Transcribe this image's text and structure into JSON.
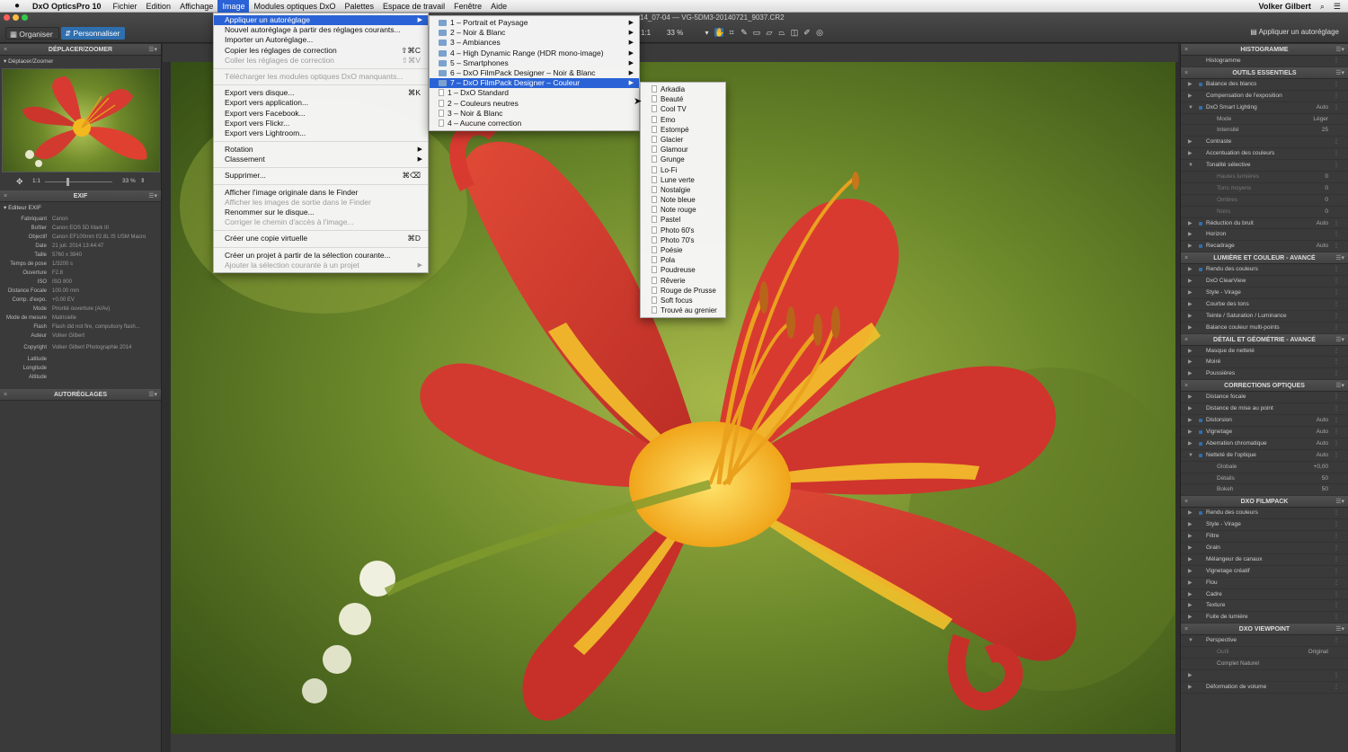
{
  "menubar": {
    "app_name": "DxO OpticsPro 10",
    "menus": [
      "Fichier",
      "Edition",
      "Affichage",
      "Image",
      "Modules optiques DxO",
      "Palettes",
      "Espace de travail",
      "Fenêtre",
      "Aide"
    ],
    "active_menu": "Image",
    "user": "Volker Gilbert"
  },
  "toolbar": {
    "document_title": "14_07-04 — VG-5DM3-20140721_9037.CR2",
    "organiser": "Organiser",
    "personnaliser": "Personnaliser",
    "ratio": "1:1",
    "zoom": "33 %",
    "apply_preset": "Appliquer un autoréglage"
  },
  "left": {
    "nav_panel_title": "DÉPLACER/ZOOMER",
    "nav_sub": "Déplacer/Zoomer",
    "zoom_ratio": "1:1",
    "zoom_value": "33 %",
    "exif_title": "EXIF",
    "exif_sub": "Editeur EXIF",
    "exif": [
      {
        "k": "Fabriquant",
        "v": "Canon"
      },
      {
        "k": "Boîtier",
        "v": "Canon EOS 5D Mark III"
      },
      {
        "k": "Objectif",
        "v": "Canon EF100mm f/2.8L IS USM Macro"
      },
      {
        "k": "Date",
        "v": "21 juil. 2014 13:44:47"
      },
      {
        "k": "Taille",
        "v": "5760 x 3840"
      },
      {
        "k": "Temps de pose",
        "v": "1/3200 s"
      },
      {
        "k": "Ouverture",
        "v": "F2.8"
      },
      {
        "k": "ISO",
        "v": "ISO 800"
      },
      {
        "k": "Distance Focale",
        "v": "100.00 mm"
      },
      {
        "k": "Comp. d'expo.",
        "v": "+0.00 EV"
      },
      {
        "k": "Mode",
        "v": "Priorité ouverture (A/Av)"
      },
      {
        "k": "Mode de mesure",
        "v": "Matricielle"
      },
      {
        "k": "Flash",
        "v": "Flash did not fire, compulsory flash..."
      },
      {
        "k": "Auteur",
        "v": "Volker Gilbert"
      },
      {
        "k": "Copyright",
        "v": "Volker Gilbert Photographie 2014"
      },
      {
        "k": "Latitude",
        "v": ""
      },
      {
        "k": "Longitude",
        "v": ""
      },
      {
        "k": "Altitude",
        "v": ""
      }
    ],
    "presets_title": "AUTORÉGLAGES"
  },
  "image_menu": [
    {
      "label": "Appliquer un autoréglage",
      "sub": true,
      "hl": true
    },
    {
      "label": "Nouvel autoréglage à partir des réglages courants..."
    },
    {
      "label": "Importer un Autoréglage..."
    },
    {
      "label": "Copier les réglages de correction",
      "sc": "⇧⌘C"
    },
    {
      "label": "Coller les réglages de correction",
      "sc": "⇧⌘V",
      "dis": true
    },
    {
      "sep": true
    },
    {
      "label": "Télécharger les modules optiques DxO manquants...",
      "dis": true
    },
    {
      "sep": true
    },
    {
      "label": "Export vers disque...",
      "sc": "⌘K"
    },
    {
      "label": "Export vers application..."
    },
    {
      "label": "Export vers Facebook..."
    },
    {
      "label": "Export vers Flickr..."
    },
    {
      "label": "Export vers Lightroom..."
    },
    {
      "sep": true
    },
    {
      "label": "Rotation",
      "sub": true
    },
    {
      "label": "Classement",
      "sub": true
    },
    {
      "sep": true
    },
    {
      "label": "Supprimer...",
      "sc": "⌘⌫"
    },
    {
      "sep": true
    },
    {
      "label": "Afficher l'image originale dans le Finder"
    },
    {
      "label": "Afficher les images de sortie dans le Finder",
      "dis": true
    },
    {
      "label": "Renommer sur le disque..."
    },
    {
      "label": "Corriger le chemin d'accès à l'image...",
      "dis": true
    },
    {
      "sep": true
    },
    {
      "label": "Créer une copie virtuelle",
      "sc": "⌘D"
    },
    {
      "sep": true
    },
    {
      "label": "Créer un projet à partir de la sélection courante..."
    },
    {
      "label": "Ajouter la sélection courante à un projet",
      "sub": true,
      "dis": true
    }
  ],
  "preset_menu": [
    {
      "label": "1 – Portrait et Paysage",
      "folder": true,
      "sub": true
    },
    {
      "label": "2 – Noir & Blanc",
      "folder": true,
      "sub": true
    },
    {
      "label": "3 – Ambiances",
      "folder": true,
      "sub": true
    },
    {
      "label": "4 – High Dynamic Range (HDR mono-image)",
      "folder": true,
      "sub": true
    },
    {
      "label": "5 – Smartphones",
      "folder": true,
      "sub": true
    },
    {
      "label": "6 – DxO FilmPack Designer – Noir & Blanc",
      "folder": true,
      "sub": true
    },
    {
      "label": "7 – DxO FilmPack Designer – Couleur",
      "folder": true,
      "sub": true,
      "hl": true
    },
    {
      "label": "1 – DxO Standard",
      "file": true
    },
    {
      "label": "2 – Couleurs neutres",
      "file": true
    },
    {
      "label": "3 – Noir & Blanc",
      "file": true
    },
    {
      "label": "4 – Aucune correction",
      "file": true
    }
  ],
  "filmpack_menu": [
    "Arkadia",
    "Beauté",
    "Cool TV",
    "Emo",
    "Estompé",
    "Glacier",
    "Glamour",
    "Grunge",
    "Lo-Fi",
    "Lune verte",
    "Nostalgie",
    "Note bleue",
    "Note rouge",
    "Pastel",
    "Photo 60's",
    "Photo 70's",
    "Poésie",
    "Pola",
    "Poudreuse",
    "Rêverie",
    "Rouge de Prusse",
    "Soft focus",
    "Trouvé au grenier"
  ],
  "right": {
    "sections": [
      {
        "title": "HISTOGRAMME",
        "rows": [
          {
            "label": "Histogramme",
            "tri": false
          }
        ]
      },
      {
        "title": "OUTILS ESSENTIELS",
        "rows": [
          {
            "label": "Balance des blancs",
            "dot": true
          },
          {
            "label": "Compensation de l'exposition"
          },
          {
            "label": "DxO Smart Lighting",
            "dot": true,
            "val": "Auto",
            "open": true
          },
          {
            "label": "Mode",
            "sub": true,
            "val": "Léger"
          },
          {
            "label": "Intensité",
            "sub": true,
            "val": "25"
          },
          {
            "label": "Contraste"
          },
          {
            "label": "Accentuation des couleurs"
          },
          {
            "label": "Tonalité sélective",
            "open": true
          },
          {
            "label": "Hautes lumières",
            "sub": true,
            "dim": true,
            "val": "0"
          },
          {
            "label": "Tons moyens",
            "sub": true,
            "dim": true,
            "val": "0"
          },
          {
            "label": "Ombres",
            "sub": true,
            "dim": true,
            "val": "0"
          },
          {
            "label": "Noirs",
            "sub": true,
            "dim": true,
            "val": "0"
          },
          {
            "label": "Réduction du bruit",
            "dot": true,
            "val": "Auto"
          },
          {
            "label": "Horizon"
          },
          {
            "label": "Recadrage",
            "dot": true,
            "val": "Auto"
          }
        ]
      },
      {
        "title": "LUMIÈRE ET COULEUR - AVANCÉ",
        "rows": [
          {
            "label": "Rendu des couleurs",
            "dot": true
          },
          {
            "label": "DxO ClearView"
          },
          {
            "label": "Style - Virage"
          },
          {
            "label": "Courbe des tons"
          },
          {
            "label": "Teinte / Saturation / Luminance"
          },
          {
            "label": "Balance couleur multi-points"
          }
        ]
      },
      {
        "title": "DÉTAIL ET GÉOMÉTRIE - AVANCÉ",
        "rows": [
          {
            "label": "Masque de netteté"
          },
          {
            "label": "Moiré"
          },
          {
            "label": "Poussières"
          }
        ]
      },
      {
        "title": "CORRECTIONS OPTIQUES",
        "rows": [
          {
            "label": "Distance focale"
          },
          {
            "label": "Distance de mise au point"
          },
          {
            "label": "Distorsion",
            "dot": true,
            "val": "Auto"
          },
          {
            "label": "Vignetage",
            "dot": true,
            "val": "Auto"
          },
          {
            "label": "Aberration chromatique",
            "dot": true,
            "val": "Auto"
          },
          {
            "label": "Netteté de l'optique",
            "dot": true,
            "val": "Auto",
            "open": true
          },
          {
            "label": "Globale",
            "sub": true,
            "val": "+0,00"
          },
          {
            "label": "Détails",
            "sub": true,
            "val": "50"
          },
          {
            "label": "Bokeh",
            "sub": true,
            "val": "50"
          }
        ]
      },
      {
        "title": "DXO FILMPACK",
        "rows": [
          {
            "label": "Rendu des couleurs",
            "dot": true
          },
          {
            "label": "Style - Virage"
          },
          {
            "label": "Filtre"
          },
          {
            "label": "Grain"
          },
          {
            "label": "Mélangeur de canaux"
          },
          {
            "label": "Vignetage créatif"
          },
          {
            "label": "Flou"
          },
          {
            "label": "Cadre"
          },
          {
            "label": "Texture"
          },
          {
            "label": "Fuite de lumière"
          }
        ]
      },
      {
        "title": "DXO VIEWPOINT",
        "rows": [
          {
            "label": "Perspective",
            "open": true
          },
          {
            "label": "Outil",
            "sub": true,
            "dim": true,
            "val": "Original"
          },
          {
            "label": "Complet          Naturel",
            "sub": true
          },
          {
            "label": ""
          },
          {
            "label": "Déformation de volume"
          }
        ]
      }
    ]
  },
  "colors": {
    "accent": "#2b63d6",
    "panel": "#3a3a3a",
    "petal": "#d83a32",
    "center": "#f2b81e"
  }
}
